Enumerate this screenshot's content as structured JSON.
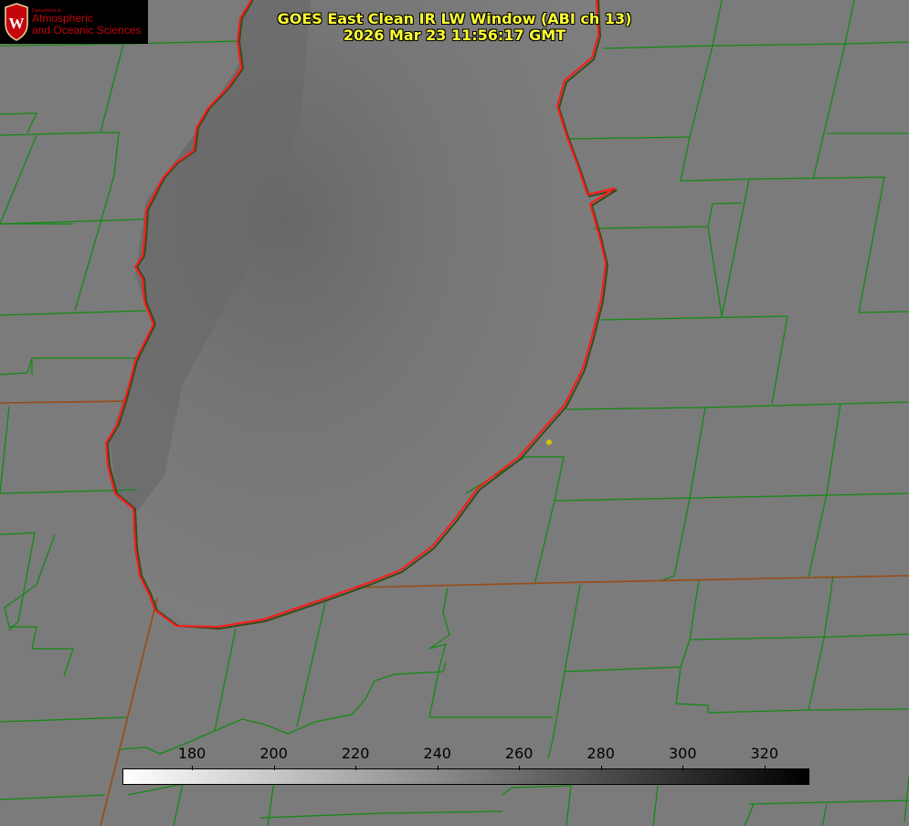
{
  "title": {
    "line1": "GOES East Clean IR LW Window (ABI ch 13)",
    "line2": "2026 Mar 23 11:56:17 GMT"
  },
  "logo": {
    "dept": "Department of",
    "line1": "Atmospheric",
    "line2": "and Oceanic Sciences",
    "seal_letter": "W",
    "color": "#c5050c"
  },
  "colorbar": {
    "min": 163,
    "max": 331,
    "ticks": [
      "180",
      "200",
      "220",
      "240",
      "260",
      "280",
      "300",
      "320"
    ],
    "tick_values": [
      180,
      200,
      220,
      240,
      260,
      280,
      300,
      320
    ]
  },
  "colors": {
    "title": "#ffff33",
    "county_lines": "#138a13",
    "state_lines": "#9a4a14",
    "coastline": "#ff1a1a",
    "marker": "#d6c400",
    "background_ir": "#7d7d7d"
  }
}
